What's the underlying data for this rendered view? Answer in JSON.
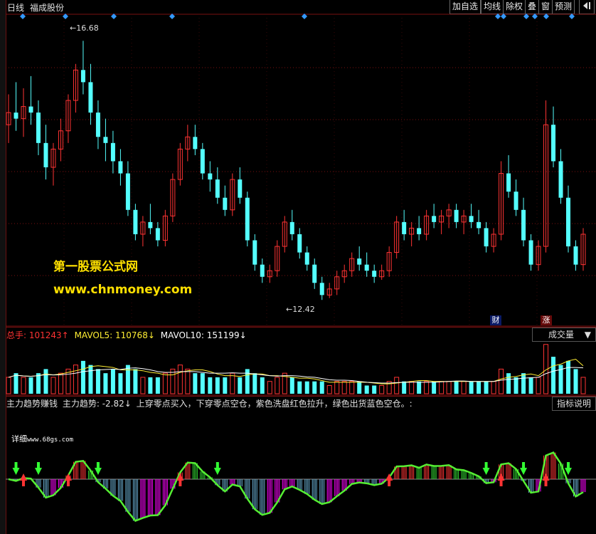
{
  "topbar": {
    "period": "日线",
    "stock_name": "福成股份",
    "buttons": [
      "加自选",
      "均线",
      "除权",
      "叠",
      "窗",
      "预测"
    ],
    "nav_icon": "split-arrow-icon"
  },
  "price_panel": {
    "high_label": "16.68",
    "low_label": "12.42",
    "markers": [
      "财",
      "涨"
    ]
  },
  "watermark": {
    "line1": "第一股票公式网",
    "line2": "www.chnmoney.com"
  },
  "volume_panel": {
    "total_label": "总手:",
    "total_value": "101243↑",
    "mavol5_label": "MAVOL5:",
    "mavol5_value": "110768↓",
    "mavol10_label": "MAVOL10:",
    "mavol10_value": "151199↓",
    "dropdown": "成交量"
  },
  "indicator_panel": {
    "name": "主力趋势赚钱",
    "trend_label": "主力趋势:",
    "trend_value": "-2.82↓",
    "description": "上穿零点买入，下穿零点空仓，紫色洗盘红色拉升，绿色出货蓝色空仓。:",
    "help_button": "指标说明",
    "detail_label": "详细",
    "detail_url": "www.68gs.com"
  },
  "colors": {
    "up": "#ff3333",
    "down": "#54ffff",
    "grid": "#7a1010",
    "watermark": "#ffe000",
    "purple": "#ff00ff",
    "green": "#33dd33"
  },
  "chart_data": {
    "type": "candlestick",
    "ohlc": [
      [
        15.3,
        15.8,
        15.0,
        15.5
      ],
      [
        15.5,
        16.0,
        15.2,
        15.4
      ],
      [
        15.4,
        15.9,
        15.1,
        15.6
      ],
      [
        15.6,
        16.1,
        15.3,
        15.5
      ],
      [
        15.5,
        15.7,
        14.8,
        15.0
      ],
      [
        15.0,
        15.3,
        14.4,
        14.6
      ],
      [
        14.6,
        15.0,
        14.3,
        14.9
      ],
      [
        14.9,
        15.4,
        14.7,
        15.2
      ],
      [
        15.2,
        15.8,
        15.0,
        15.7
      ],
      [
        15.7,
        16.3,
        15.5,
        16.2
      ],
      [
        16.2,
        16.68,
        15.8,
        16.0
      ],
      [
        16.0,
        16.3,
        15.3,
        15.5
      ],
      [
        15.5,
        15.7,
        14.9,
        15.1
      ],
      [
        15.1,
        15.4,
        14.7,
        15.0
      ],
      [
        15.0,
        15.2,
        14.5,
        14.7
      ],
      [
        14.7,
        14.9,
        14.3,
        14.5
      ],
      [
        14.5,
        14.7,
        13.8,
        13.9
      ],
      [
        13.9,
        14.0,
        13.4,
        13.5
      ],
      [
        13.5,
        13.8,
        13.3,
        13.7
      ],
      [
        13.7,
        14.0,
        13.5,
        13.6
      ],
      [
        13.6,
        13.7,
        13.3,
        13.4
      ],
      [
        13.4,
        13.9,
        13.3,
        13.8
      ],
      [
        13.8,
        14.5,
        13.7,
        14.4
      ],
      [
        14.4,
        15.0,
        14.3,
        14.9
      ],
      [
        14.9,
        15.3,
        14.7,
        15.1
      ],
      [
        15.1,
        15.3,
        14.8,
        14.9
      ],
      [
        14.9,
        15.0,
        14.4,
        14.5
      ],
      [
        14.5,
        14.7,
        14.2,
        14.4
      ],
      [
        14.4,
        14.6,
        14.0,
        14.1
      ],
      [
        14.1,
        14.3,
        13.8,
        13.9
      ],
      [
        13.9,
        14.5,
        13.8,
        14.4
      ],
      [
        14.4,
        14.6,
        14.0,
        14.1
      ],
      [
        14.1,
        14.2,
        13.3,
        13.4
      ],
      [
        13.4,
        13.5,
        12.9,
        13.0
      ],
      [
        13.0,
        13.1,
        12.7,
        12.8
      ],
      [
        12.8,
        13.0,
        12.7,
        12.9
      ],
      [
        12.9,
        13.4,
        12.8,
        13.3
      ],
      [
        13.3,
        13.8,
        13.2,
        13.7
      ],
      [
        13.7,
        13.9,
        13.4,
        13.5
      ],
      [
        13.5,
        13.6,
        13.1,
        13.2
      ],
      [
        13.2,
        13.3,
        12.9,
        13.0
      ],
      [
        13.0,
        13.1,
        12.6,
        12.7
      ],
      [
        12.7,
        12.8,
        12.42,
        12.5
      ],
      [
        12.5,
        12.7,
        12.45,
        12.6
      ],
      [
        12.6,
        12.9,
        12.5,
        12.8
      ],
      [
        12.8,
        13.0,
        12.7,
        12.9
      ],
      [
        12.9,
        13.2,
        12.8,
        13.1
      ],
      [
        13.1,
        13.3,
        12.9,
        13.0
      ],
      [
        13.0,
        13.2,
        12.8,
        12.9
      ],
      [
        12.9,
        13.0,
        12.7,
        12.8
      ],
      [
        12.8,
        13.0,
        12.75,
        12.9
      ],
      [
        12.9,
        13.3,
        12.8,
        13.2
      ],
      [
        13.2,
        13.8,
        13.1,
        13.7
      ],
      [
        13.7,
        13.9,
        13.4,
        13.5
      ],
      [
        13.5,
        13.7,
        13.3,
        13.6
      ],
      [
        13.6,
        13.8,
        13.4,
        13.5
      ],
      [
        13.5,
        13.9,
        13.4,
        13.8
      ],
      [
        13.8,
        14.0,
        13.6,
        13.7
      ],
      [
        13.7,
        13.9,
        13.5,
        13.8
      ],
      [
        13.8,
        14.0,
        13.6,
        13.9
      ],
      [
        13.9,
        14.0,
        13.6,
        13.7
      ],
      [
        13.7,
        13.9,
        13.5,
        13.8
      ],
      [
        13.8,
        14.0,
        13.6,
        13.7
      ],
      [
        13.7,
        13.9,
        13.5,
        13.6
      ],
      [
        13.6,
        13.7,
        13.2,
        13.3
      ],
      [
        13.3,
        13.6,
        13.2,
        13.5
      ],
      [
        13.5,
        14.7,
        13.4,
        14.5
      ],
      [
        14.5,
        14.8,
        14.1,
        14.2
      ],
      [
        14.2,
        14.4,
        13.8,
        13.9
      ],
      [
        13.9,
        14.1,
        13.3,
        13.4
      ],
      [
        13.4,
        13.5,
        12.9,
        13.0
      ],
      [
        13.0,
        13.4,
        12.9,
        13.3
      ],
      [
        13.3,
        15.7,
        13.2,
        15.3
      ],
      [
        15.3,
        15.6,
        14.6,
        14.7
      ],
      [
        14.7,
        14.9,
        14.0,
        14.1
      ],
      [
        14.1,
        14.3,
        13.2,
        13.3
      ],
      [
        13.3,
        13.4,
        12.9,
        13.0
      ],
      [
        13.0,
        13.6,
        12.9,
        13.5
      ]
    ],
    "volume": [
      4,
      5,
      4,
      4,
      5,
      6,
      4,
      5,
      6,
      7,
      8,
      7,
      6,
      5,
      6,
      5,
      7,
      6,
      4,
      4,
      4,
      5,
      6,
      7,
      6,
      5,
      5,
      4,
      4,
      4,
      5,
      4,
      6,
      5,
      4,
      3,
      4,
      5,
      4,
      3,
      3,
      3,
      3,
      2,
      3,
      3,
      3,
      3,
      2,
      2,
      2,
      3,
      4,
      3,
      3,
      3,
      3,
      3,
      3,
      3,
      3,
      3,
      3,
      3,
      3,
      3,
      6,
      5,
      4,
      5,
      4,
      4,
      12,
      9,
      7,
      8,
      6,
      4
    ]
  }
}
